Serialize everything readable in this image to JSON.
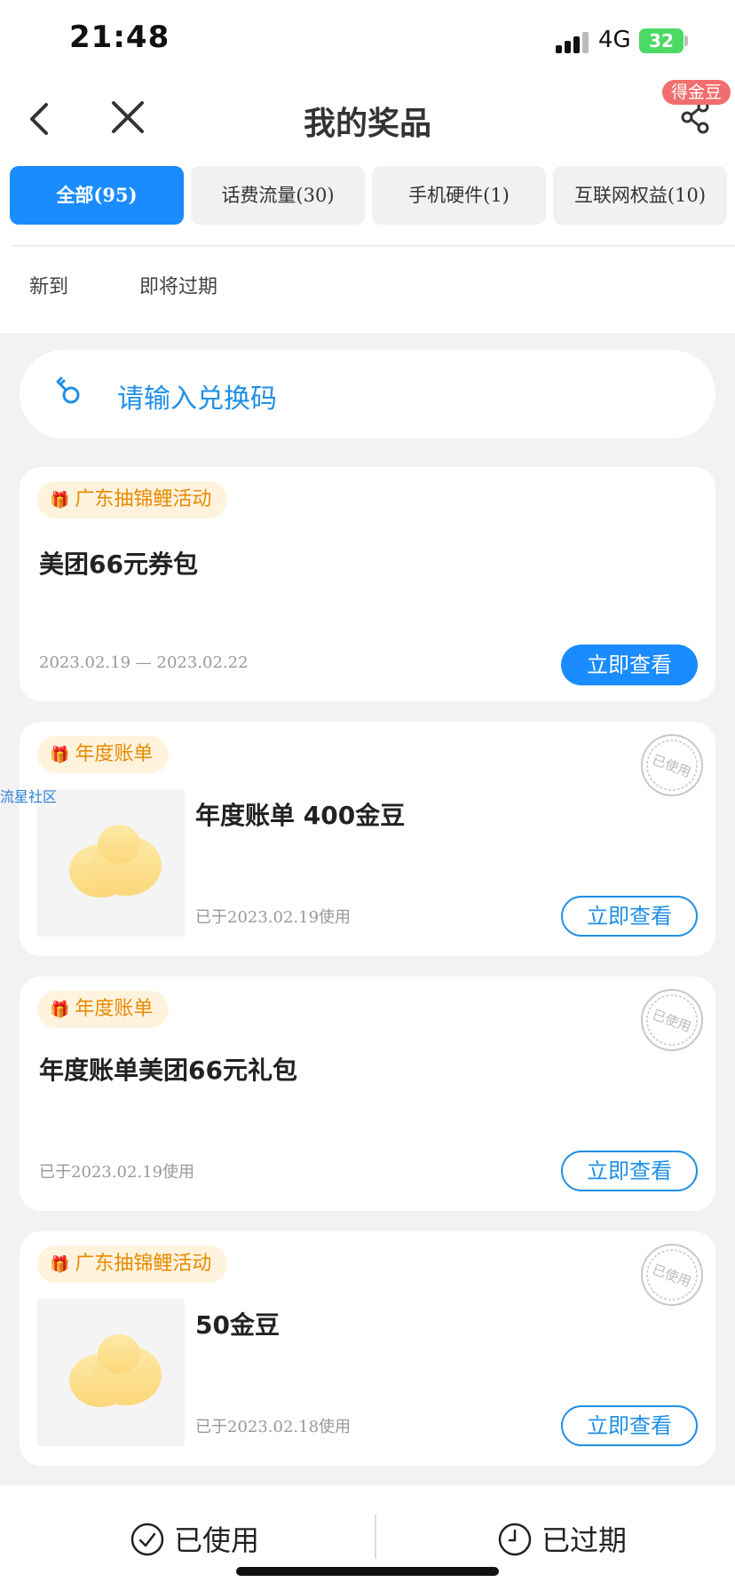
{
  "status_bar": {
    "time": "21:48",
    "network": "4G",
    "battery": "32"
  },
  "nav": {
    "title": "我的奖品",
    "badge": "得金豆"
  },
  "tabs": [
    {
      "label": "全部(95)"
    },
    {
      "label": "话费流量(30)"
    },
    {
      "label": "手机硬件(1)"
    },
    {
      "label": "互联网权益(10)"
    }
  ],
  "subtabs": [
    "新到",
    "即将过期"
  ],
  "redeem": {
    "placeholder": "请输入兑换码"
  },
  "watermark": "流星社区",
  "cards": [
    {
      "tag": "广东抽锦鲤活动",
      "title": "美团66元券包",
      "date": "2023.02.19 — 2023.02.22",
      "button": "立即查看"
    },
    {
      "tag": "年度账单",
      "title": "年度账单 400金豆",
      "date": "已于2023.02.19使用",
      "button": "立即查看",
      "stamp": "已使用"
    },
    {
      "tag": "年度账单",
      "title": "年度账单美团66元礼包",
      "date": "已于2023.02.19使用",
      "button": "立即查看",
      "stamp": "已使用"
    },
    {
      "tag": "广东抽锦鲤活动",
      "title": "50金豆",
      "date": "已于2023.02.18使用",
      "button": "立即查看",
      "stamp": "已使用"
    }
  ],
  "bottom": {
    "used": "已使用",
    "expired": "已过期"
  },
  "colors": {
    "accent": "#1a8cff",
    "tag_bg": "#fff3de",
    "tag_text": "#e88a00",
    "badge": "#f26d6d"
  }
}
